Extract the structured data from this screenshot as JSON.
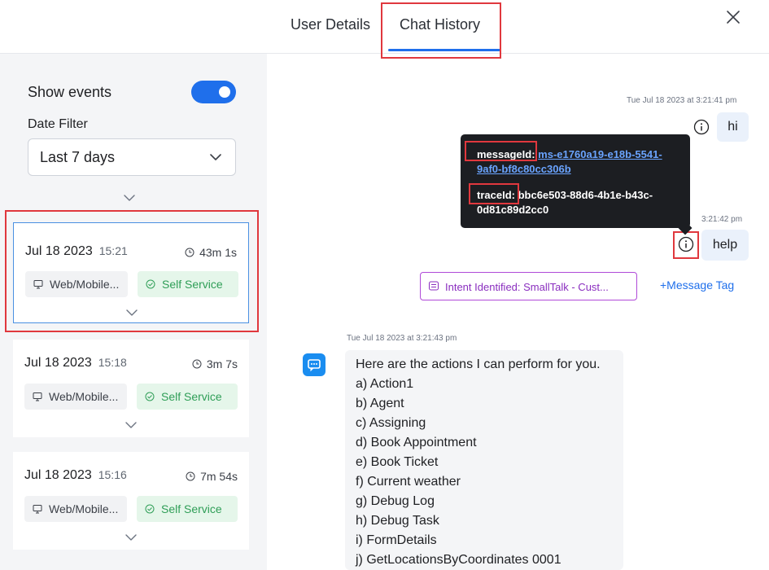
{
  "header": {
    "tabs": [
      {
        "label": "User Details"
      },
      {
        "label": "Chat History"
      }
    ]
  },
  "sidebar": {
    "show_events_label": "Show events",
    "date_filter_label": "Date Filter",
    "date_filter_value": "Last 7 days",
    "sessions": [
      {
        "date": "Jul 18 2023",
        "time": "15:21",
        "duration": "43m 1s",
        "channel": "Web/Mobile...",
        "service": "Self Service"
      },
      {
        "date": "Jul 18 2023",
        "time": "15:18",
        "duration": "3m 7s",
        "channel": "Web/Mobile...",
        "service": "Self Service"
      },
      {
        "date": "Jul 18 2023",
        "time": "15:16",
        "duration": "7m 54s",
        "channel": "Web/Mobile...",
        "service": "Self Service"
      }
    ]
  },
  "chat": {
    "msg1": {
      "timestamp": "Tue Jul 18 2023 at 3:21:41 pm",
      "text": "hi"
    },
    "tooltip": {
      "message_id_label": "messageId:",
      "message_id_value": "ms-e1760a19-e18b-5541-9af0-bf8c80cc306b",
      "trace_id_label": "traceId:",
      "trace_id_value": "bbc6e503-88d6-4b1e-b43c-0d81c89d2cc0"
    },
    "msg2": {
      "timestamp": "3:21:42 pm",
      "text": "help"
    },
    "intent_text": "Intent Identified: SmallTalk - Cust...",
    "message_tag_label": "+Message Tag",
    "bot": {
      "timestamp": "Tue Jul 18 2023 at 3:21:43 pm",
      "lines": [
        "Here are the actions I can perform for you.",
        "a) Action1",
        "b) Agent",
        "c) Assigning",
        "d) Book Appointment",
        "e) Book Ticket",
        "f) Current weather",
        "g) Debug Log",
        "h) Debug Task",
        "i) FormDetails",
        "j) GetLocationsByCoordinates 0001"
      ]
    }
  },
  "colors": {
    "accent": "#1f6feb",
    "highlight_box": "#e0383e",
    "self_service_bg": "#e5f6ea",
    "self_service_text": "#2f9e57",
    "intent_border": "#b04ad8",
    "tooltip_bg": "#1c1e22"
  },
  "icons": [
    "close-icon",
    "chevron-down-icon",
    "clock-icon",
    "monitor-icon",
    "check-circle-icon",
    "info-icon",
    "intent-icon",
    "bot-chat-icon"
  ]
}
